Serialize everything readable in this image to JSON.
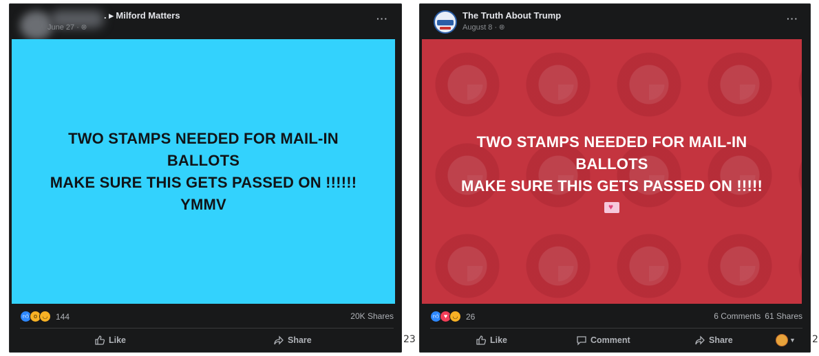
{
  "post1": {
    "page_name": "Milford Matters",
    "date": "June 27 ·",
    "image_lines": [
      "TWO STAMPS NEEDED FOR MAIL-IN",
      "BALLOTS",
      "MAKE SURE THIS GETS PASSED ON !!!!!!",
      "YMMV"
    ],
    "reaction_count": "144",
    "shares": "20K Shares",
    "like_label": "Like",
    "share_label": "Share",
    "image_bg": "#33d2fd"
  },
  "post2": {
    "page_name": "The Truth About Trump",
    "date": "August 8 ·",
    "image_lines": [
      "TWO STAMPS NEEDED FOR MAIL-IN",
      "BALLOTS",
      "MAKE SURE THIS GETS PASSED ON !!!!!"
    ],
    "reaction_count": "26",
    "comments": "6 Comments",
    "shares": "61 Shares",
    "like_label": "Like",
    "comment_label": "Comment",
    "share_label": "Share",
    "image_bg": "#c4343f"
  },
  "side_numbers": [
    "23",
    "2"
  ],
  "colors": {
    "card_bg": "#18191a",
    "text_secondary": "#b0b3b8",
    "like_blue": "#2d88ff"
  }
}
